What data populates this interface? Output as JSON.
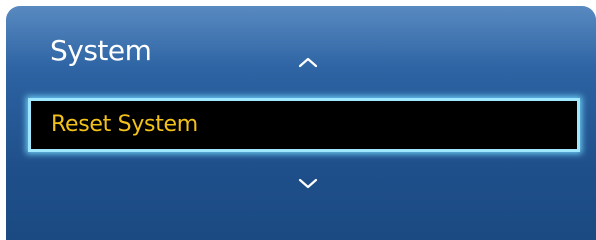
{
  "menu": {
    "title": "System",
    "selected_item": "Reset System",
    "scroll_up_icon": "chevron-up-icon",
    "scroll_down_icon": "chevron-down-icon"
  },
  "colors": {
    "panel_top": "#3d76b6",
    "panel_bottom": "#1b4a82",
    "selected_text": "#f2c21b",
    "highlight_border": "#9fe7ff",
    "title_text": "#ffffff"
  }
}
